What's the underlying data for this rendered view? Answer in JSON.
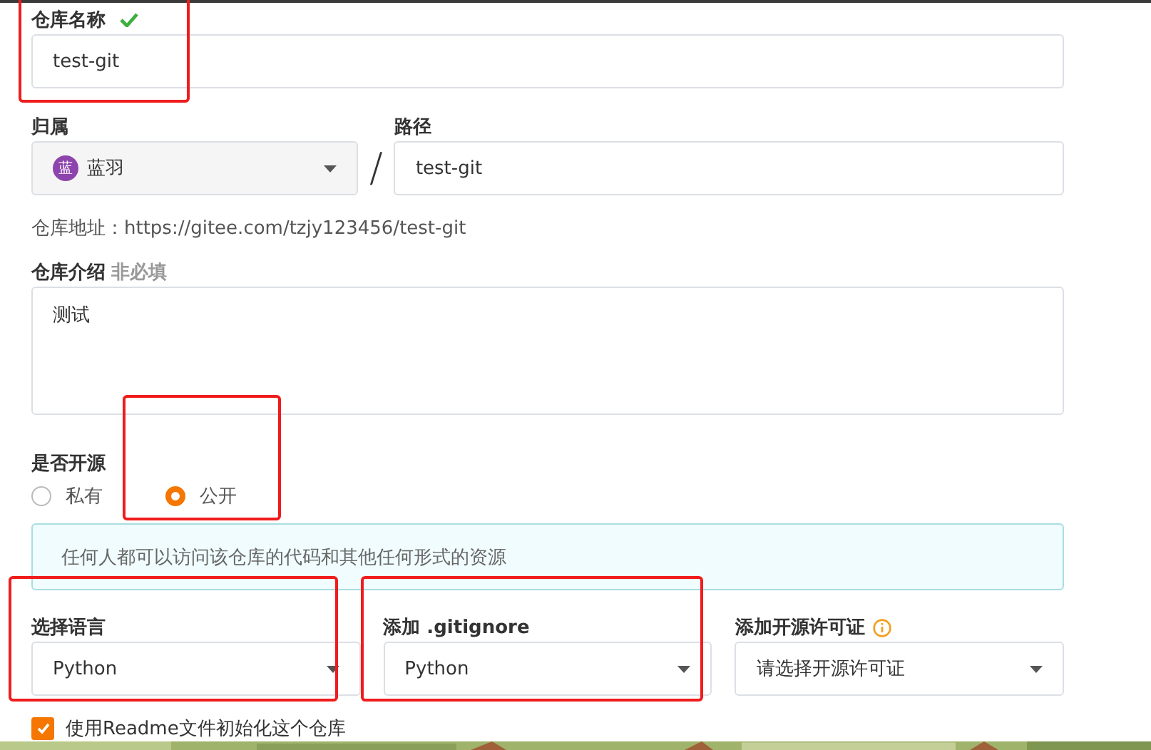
{
  "name_field": {
    "label": "仓库名称",
    "valid": true,
    "value": "test-git",
    "highlighted": true
  },
  "owner": {
    "label": "归属",
    "avatar": "蓝",
    "value": "蓝羽"
  },
  "separator": "/",
  "path": {
    "label": "路径",
    "value": "test-git"
  },
  "address": {
    "label": "仓库地址：",
    "url": "https://gitee.com/tzjy123456/test-git"
  },
  "description": {
    "label": "仓库介绍",
    "hint": "非必填",
    "value": "测试"
  },
  "visibility": {
    "label": "是否开源",
    "options": [
      {
        "label": "私有",
        "selected": false,
        "highlighted": false
      },
      {
        "label": "公开",
        "selected": true,
        "highlighted": true
      }
    ]
  },
  "notice": "任何人都可以访问该仓库的代码和其他任何形式的资源",
  "selects": [
    {
      "label": "选择语言",
      "value": "Python",
      "info": false,
      "highlighted": true
    },
    {
      "label": "添加 .gitignore",
      "value": "Python",
      "info": false,
      "highlighted": true
    },
    {
      "label": "添加开源许可证",
      "value": "请选择开源许可证",
      "info": true,
      "highlighted": false
    }
  ],
  "readme": {
    "label": "使用Readme文件初始化这个仓库",
    "checked": true
  }
}
